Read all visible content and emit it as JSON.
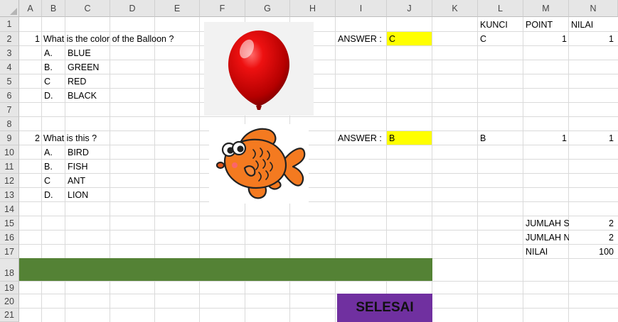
{
  "columns": [
    "A",
    "B",
    "C",
    "D",
    "E",
    "F",
    "G",
    "H",
    "I",
    "J",
    "K",
    "L",
    "M",
    "N"
  ],
  "rows": [
    "1",
    "2",
    "3",
    "4",
    "5",
    "6",
    "7",
    "8",
    "9",
    "10",
    "11",
    "12",
    "13",
    "14",
    "15",
    "16",
    "17",
    "18",
    "19",
    "20",
    "21"
  ],
  "header": {
    "kunci": "KUNCI",
    "point": "POINT",
    "nilai": "NILAI"
  },
  "q1": {
    "number": "1",
    "question": "What is the color of the Balloon ?",
    "options": [
      {
        "letter": "A.",
        "text": "BLUE"
      },
      {
        "letter": "B.",
        "text": "GREEN"
      },
      {
        "letter": "C",
        "text": "RED"
      },
      {
        "letter": "D.",
        "text": "BLACK"
      }
    ],
    "answer_label": "ANSWER :",
    "answer": "C",
    "kunci": "C",
    "point": "1",
    "nilai": "1"
  },
  "q2": {
    "number": "2",
    "question": "What is this ?",
    "options": [
      {
        "letter": "A.",
        "text": "BIRD"
      },
      {
        "letter": "B.",
        "text": "FISH"
      },
      {
        "letter": "C",
        "text": "ANT"
      },
      {
        "letter": "D.",
        "text": "LION"
      }
    ],
    "answer_label": "ANSWER :",
    "answer": "B",
    "kunci": "B",
    "point": "1",
    "nilai": "1"
  },
  "summary": [
    {
      "label": "JUMLAH S",
      "value": "2"
    },
    {
      "label": "JUMLAH N",
      "value": "2"
    },
    {
      "label": "NILAI",
      "value": "100"
    }
  ],
  "button": {
    "label": "SELESAI"
  },
  "colors": {
    "answer_fill": "#ffff00",
    "bar": "#548235",
    "button": "#7030a0"
  }
}
